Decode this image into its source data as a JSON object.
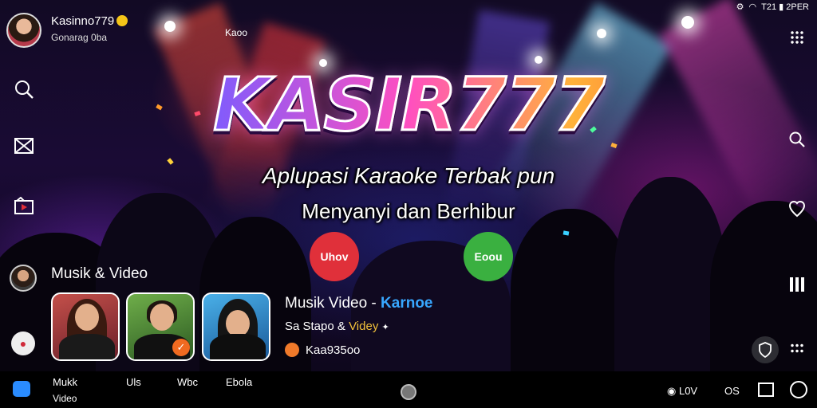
{
  "status_bar": {
    "right_text": "T21 ▮ 2PER"
  },
  "profile": {
    "name": "Kasinno779",
    "status": "Gonarag 0ba"
  },
  "top_tag": "Kaoo",
  "logo": "KASIR777",
  "subtitle_line1": "Aplupasi Karaoke Terbak pun",
  "subtitle_line2": "Menyanyi dan Berhibur",
  "cta_red": {
    "label": "Uhov",
    "color": "#e0303a"
  },
  "cta_green": {
    "label": "Eoou",
    "color": "#3ab040"
  },
  "section": {
    "title": "Musik & Video"
  },
  "thumbnails": [
    {
      "label": "singer-woman"
    },
    {
      "label": "singer-man"
    },
    {
      "label": "singer-hooded"
    }
  ],
  "info": {
    "line1_prefix": "Musik  Video - ",
    "line1_accent": "Karnoe",
    "line2_prefix": "Sa Stapo & ",
    "line2_accent": "Videy",
    "line3": "Kaa935oo"
  },
  "bottom_nav": {
    "item1_line1": "Mukk",
    "item1_line2": "Video",
    "item2": "Uls",
    "item3": "Wbc",
    "item4": "Ebola",
    "right1": "L0V",
    "right2": "OS"
  },
  "colors": {
    "accent_blue": "#38a7ff",
    "accent_yellow": "#f3c23a",
    "orange": "#f07a2a"
  },
  "icons": [
    "search-icon",
    "mail-x-icon",
    "folder-play-icon",
    "grid-dots-icon",
    "heart-pin-icon",
    "bars-icon",
    "shield-icon",
    "wifi-icon",
    "battery-icon"
  ]
}
